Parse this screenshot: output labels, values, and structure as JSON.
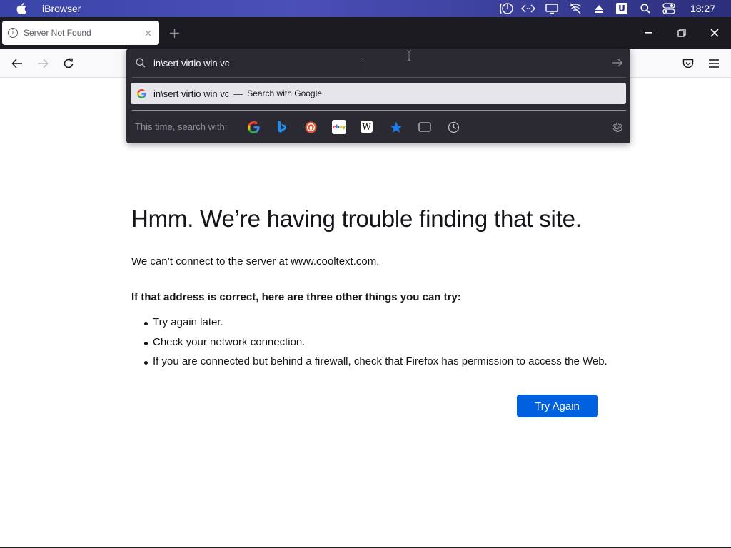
{
  "menubar": {
    "app_name": "iBrowser",
    "clock": "18:27"
  },
  "tab": {
    "title": "Server Not Found"
  },
  "urlbar": {
    "query": "in\\sert virtio win vc",
    "suggestion_query": "in\\sert virtio win vc",
    "suggestion_dash": "—",
    "suggestion_action": "Search with Google",
    "search_with_label": "This time, search with:"
  },
  "engines": [
    "google-icon",
    "bing-icon",
    "duckduckgo-icon",
    "ebay-icon",
    "wikipedia-icon",
    "bookmarks-icon",
    "tabs-icon",
    "history-icon"
  ],
  "error": {
    "title": "Hmm. We’re having trouble finding that site.",
    "description": "We can’t connect to the server at www.cooltext.com.",
    "subtitle": "If that address is correct, here are three other things you can try:",
    "items": [
      "Try again later.",
      "Check your network connection.",
      "If you are connected but behind a firewall, check that Firefox has permission to access the Web."
    ],
    "button": "Try Again"
  },
  "colors": {
    "accent": "#0061e0",
    "tabstrip": "#1c1b22",
    "popup": "#2b2a33"
  }
}
